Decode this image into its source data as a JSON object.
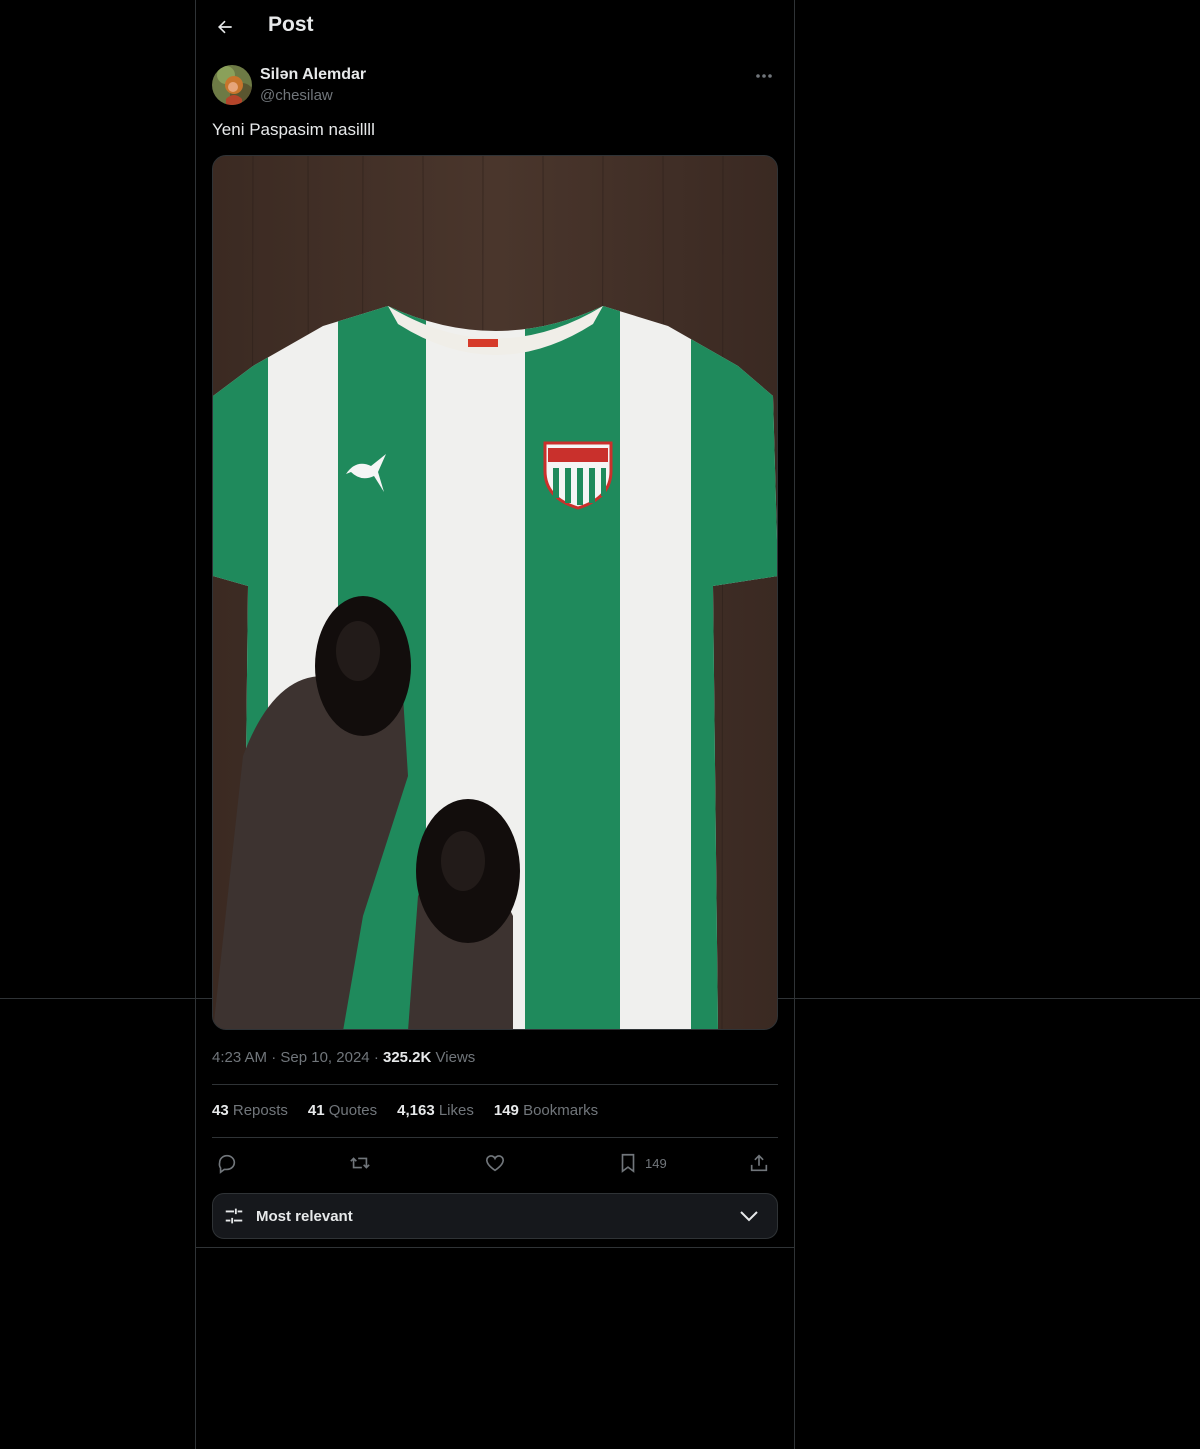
{
  "header": {
    "title": "Post"
  },
  "author": {
    "name": "Silən Alemdar",
    "handle": "@chesilaw"
  },
  "post": {
    "text": "Yeni Paspasim nasillll",
    "time": "4:23 AM",
    "date": "Sep 10, 2024",
    "views_count": "325.2K",
    "views_label": "Views"
  },
  "stats": {
    "reposts_count": "43",
    "reposts_label": "Reposts",
    "quotes_count": "41",
    "quotes_label": "Quotes",
    "likes_count": "4,163",
    "likes_label": "Likes",
    "bookmarks_count": "149",
    "bookmarks_label": "Bookmarks"
  },
  "actions": {
    "bookmark_count": "149"
  },
  "replies_sort": {
    "label": "Most relevant"
  },
  "colors": {
    "background": "#000000",
    "border": "#2f3336",
    "muted": "#71767b",
    "text": "#e7e9ea"
  },
  "icons": [
    "back-arrow-icon",
    "more-icon",
    "reply-icon",
    "repost-icon",
    "like-icon",
    "bookmark-icon",
    "share-icon",
    "sliders-icon",
    "chevron-down-icon"
  ]
}
